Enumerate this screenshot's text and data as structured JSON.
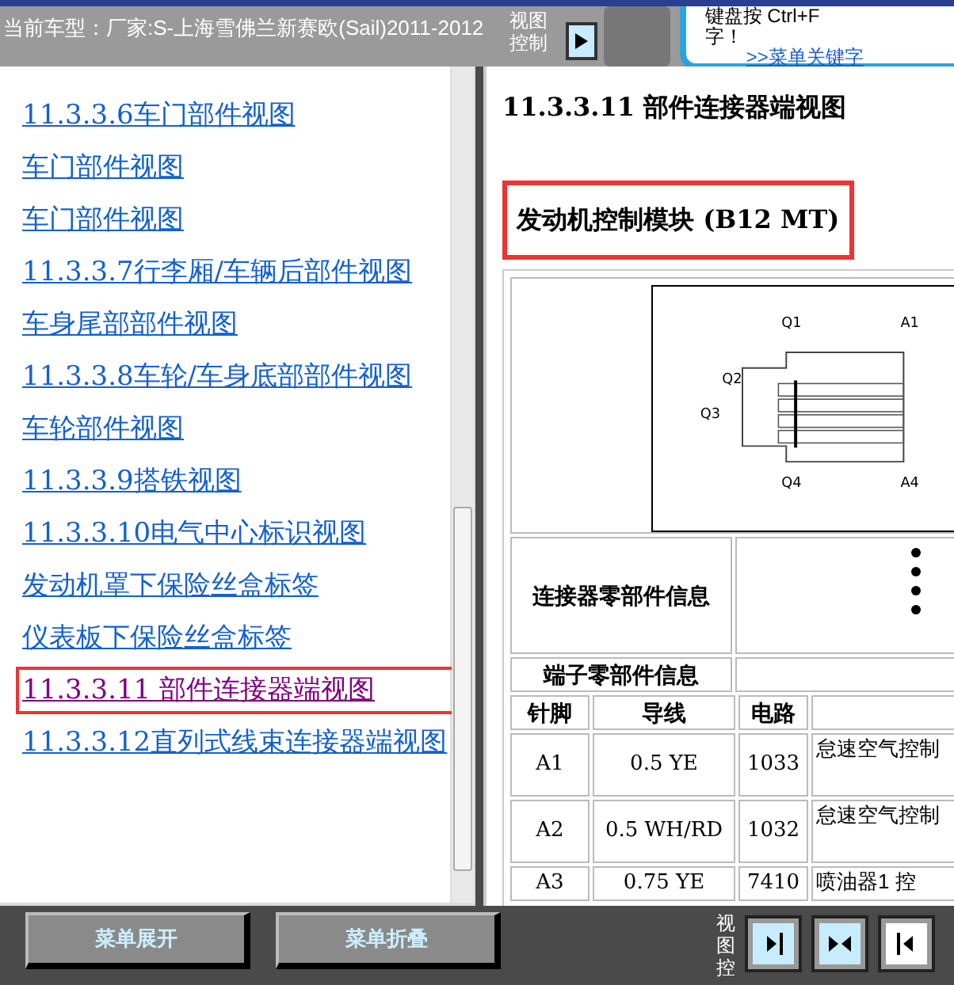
{
  "header": {
    "vehicle": "当前车型：厂家:S-上海雪佛兰新赛欧(Sail)2011-2012",
    "view_control": "视图控制",
    "help_line1": "键盘按 Ctrl+F",
    "help_line2": "字！",
    "help_link": ">>菜单关键字"
  },
  "menu": [
    {
      "label": "11.3.3.6车门部件视图",
      "selected": false
    },
    {
      "label": "车门部件视图",
      "selected": false
    },
    {
      "label": "车门部件视图",
      "selected": false
    },
    {
      "label": "11.3.3.7行李厢/车辆后部件视图",
      "selected": false
    },
    {
      "label": "车身尾部部件视图",
      "selected": false
    },
    {
      "label": "11.3.3.8车轮/车身底部部件视图",
      "selected": false
    },
    {
      "label": "车轮部件视图",
      "selected": false
    },
    {
      "label": "11.3.3.9搭铁视图",
      "selected": false
    },
    {
      "label": "11.3.3.10电气中心标识视图",
      "selected": false
    },
    {
      "label": "发动机罩下保险丝盒标签",
      "selected": false
    },
    {
      "label": "仪表板下保险丝盒标签",
      "selected": false
    },
    {
      "label": "11.3.3.11 部件连接器端视图",
      "selected": true
    },
    {
      "label": "11.3.3.12直列式线束连接器端视图",
      "selected": false
    }
  ],
  "content": {
    "title": "11.3.3.11 部件连接器端视图",
    "heading": "发动机控制模块 (B12 MT)",
    "diagram_labels": [
      "Q1",
      "A1",
      "Q2",
      "Q3",
      "Q4",
      "A4"
    ],
    "connector_info": "连接器零部件信息",
    "terminal_info": "端子零部件信息",
    "columns": [
      "针脚",
      "导线",
      "电路"
    ],
    "rows": [
      {
        "pin": "A1",
        "wire": "0.5 YE",
        "circuit": "1033",
        "function": "怠速空气控制"
      },
      {
        "pin": "A2",
        "wire": "0.5 WH/RD",
        "circuit": "1032",
        "function": "怠速空气控制"
      },
      {
        "pin": "A3",
        "wire": "0.75 YE",
        "circuit": "7410",
        "function": "喷油器1 控"
      }
    ]
  },
  "footer": {
    "buttons": [
      "菜单展开",
      "菜单折叠"
    ],
    "view_control": "视图控"
  }
}
